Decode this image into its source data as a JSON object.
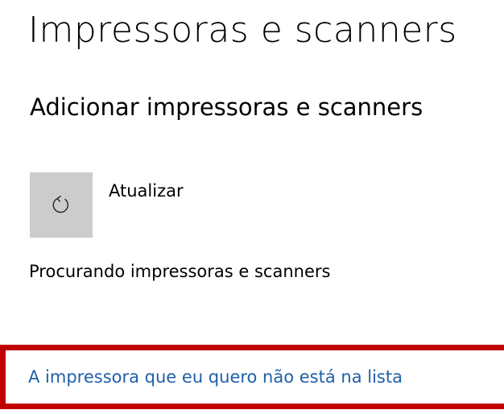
{
  "page": {
    "title": "Impressoras e scanners"
  },
  "add_section": {
    "title": "Adicionar impressoras e scanners",
    "refresh": {
      "label": "Atualizar",
      "icon": "refresh-icon"
    },
    "status": "Procurando impressoras e scanners",
    "missing_printer_link": "A impressora que eu quero não está na lista"
  },
  "colors": {
    "link": "#1e5faa",
    "tile_background": "#cccccc",
    "highlight_border": "#c00000"
  }
}
